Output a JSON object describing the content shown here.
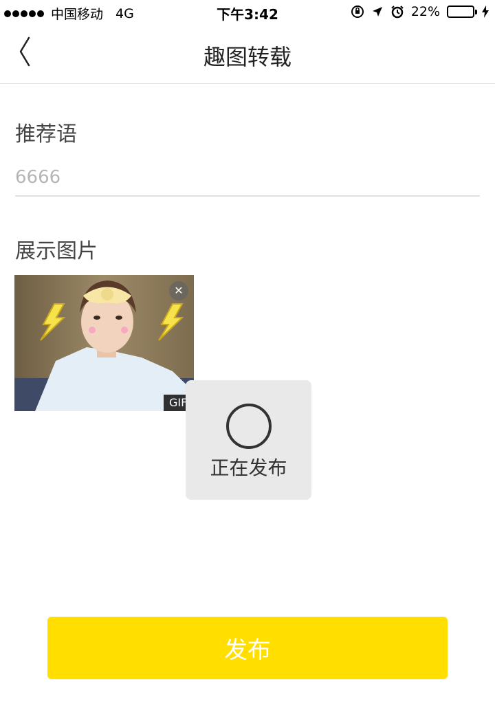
{
  "status_bar": {
    "carrier": "中国移动",
    "network": "4G",
    "time": "下午3:42",
    "battery_percent": "22%",
    "battery_level": 0.22,
    "battery_color": "#4cd964"
  },
  "nav": {
    "back_icon": "chevron-left-icon",
    "title": "趣图转载"
  },
  "form": {
    "recommend_label": "推荐语",
    "recommend_placeholder": "6666",
    "images_label": "展示图片",
    "image": {
      "remove_icon": "close-icon",
      "badge": "GIF"
    }
  },
  "toast": {
    "text": "正在发布",
    "icon": "loading-spinner-icon"
  },
  "publish_button": {
    "label": "发布",
    "color": "#ffde00"
  }
}
